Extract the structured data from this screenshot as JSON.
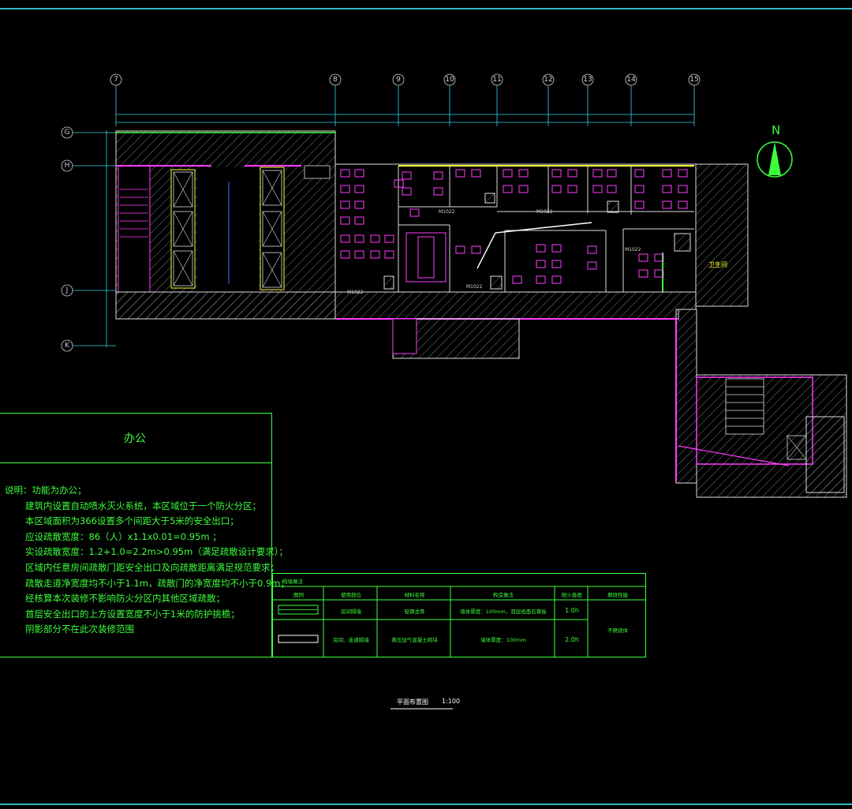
{
  "drawing": {
    "north_label": "N",
    "grid_axes_top": [
      "7",
      "8",
      "9",
      "10",
      "11",
      "12",
      "13",
      "14",
      "15"
    ],
    "grid_axes_left": [
      "G",
      "H",
      "J",
      "K"
    ],
    "room_labels": {
      "service_room": "卫生间",
      "door_m1": "M1022",
      "door_m2": "M1022",
      "door_m3": "M1022",
      "door_m4": "M1022",
      "door_m5": "M1022"
    }
  },
  "panel": {
    "title": "办公",
    "notes": [
      "说明：功能为办公；",
      "建筑内设置自动喷水灭火系统，本区域位于一个防火分区；",
      "本区域面积为366设置多个间距大于5米的安全出口；",
      "应设疏散宽度：86（人）x1.1x0.01=0.95m ；",
      "实设疏散宽度：1.2+1.0=2.2m>0.95m（满足疏散设计要求）；",
      "区域内任意房间疏散门距安全出口及向疏散距离满足规范要求；",
      "疏散走道净宽度均不小于1.1m，疏散门的净宽度均不小于0.9m；",
      "经核算本次装修不影响防火分区内其他区域疏散；",
      "首层安全出口的上方设置宽度不小于1米的防护挑檐；",
      "阴影部分不在此次装修范围"
    ]
  },
  "legend": {
    "title": "隔墙做法",
    "headers": [
      "图例",
      "使用部位",
      "材料名称",
      "构造做法",
      "耐火极限",
      "燃烧性能"
    ],
    "rows": [
      {
        "location": "房间隔墙",
        "material": "轻钢龙骨",
        "construction": "墙体厚度：100mm，双层纸面石膏板",
        "fire_limit": "1.0h"
      },
      {
        "location": "房间、走道隔墙",
        "material": "蒸压加气混凝土砌块",
        "construction": "墙体厚度：100mm",
        "fire_limit": "2.0h"
      }
    ],
    "combustion": "不燃烧体"
  },
  "caption": {
    "title": "平面布置图",
    "scale": "1:100"
  },
  "colors": {
    "frame": "#2fb7c4",
    "green": "#3cff3c",
    "magenta": "#ff3cff",
    "cyan": "#35d2e6",
    "yellow": "#ffff30",
    "hatch": "#bdbdbd",
    "blue": "#3a6bff"
  }
}
